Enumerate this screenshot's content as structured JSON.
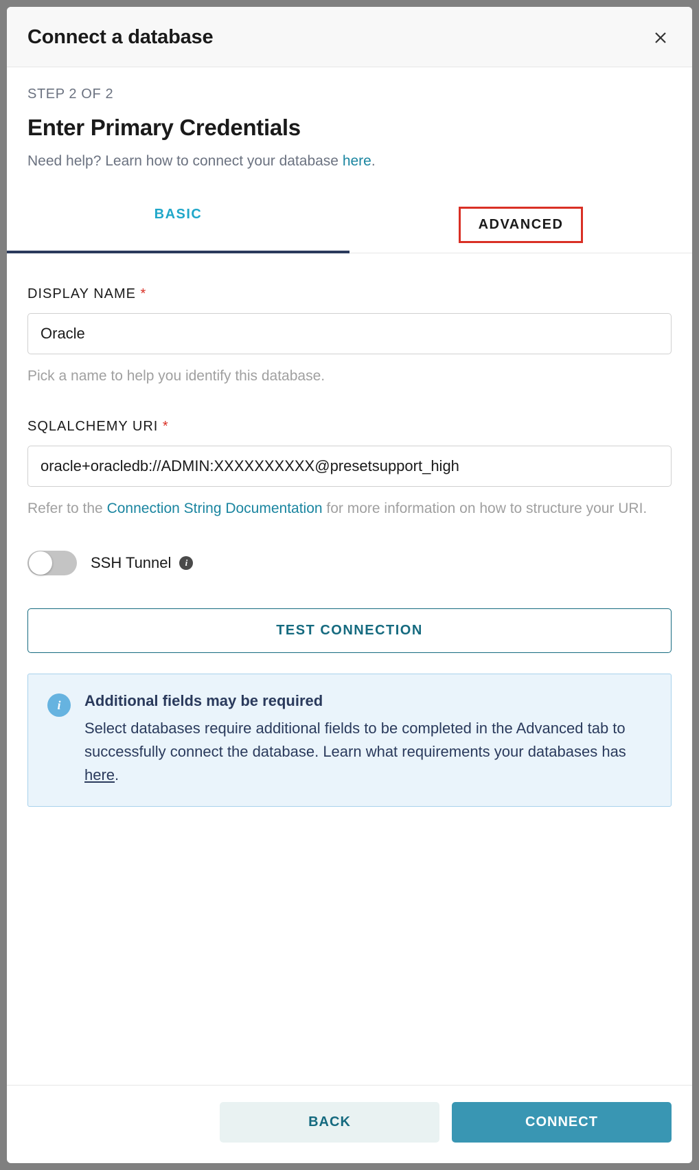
{
  "modal": {
    "title": "Connect a database",
    "step": "STEP 2 OF 2",
    "section_title": "Enter Primary Credentials",
    "help_prefix": "Need help? Learn how to connect your database ",
    "help_link": "here",
    "help_suffix": "."
  },
  "tabs": {
    "basic": "BASIC",
    "advanced": "ADVANCED"
  },
  "fields": {
    "display_name": {
      "label": "DISPLAY NAME",
      "value": "Oracle",
      "hint": "Pick a name to help you identify this database."
    },
    "sqlalchemy_uri": {
      "label": "SQLALCHEMY URI",
      "value": "oracle+oracledb://ADMIN:XXXXXXXXXX@presetsupport_high",
      "hint_prefix": "Refer to the ",
      "hint_link": "Connection String Documentation",
      "hint_suffix": " for more information on how to structure your URI."
    },
    "ssh_tunnel": {
      "label": "SSH Tunnel"
    }
  },
  "buttons": {
    "test": "TEST CONNECTION",
    "back": "BACK",
    "connect": "CONNECT"
  },
  "info_box": {
    "title": "Additional fields may be required",
    "text_prefix": "Select databases require additional fields to be completed in the Advanced tab to successfully connect the database. Learn what requirements your databases has ",
    "text_link": "here",
    "text_suffix": "."
  }
}
